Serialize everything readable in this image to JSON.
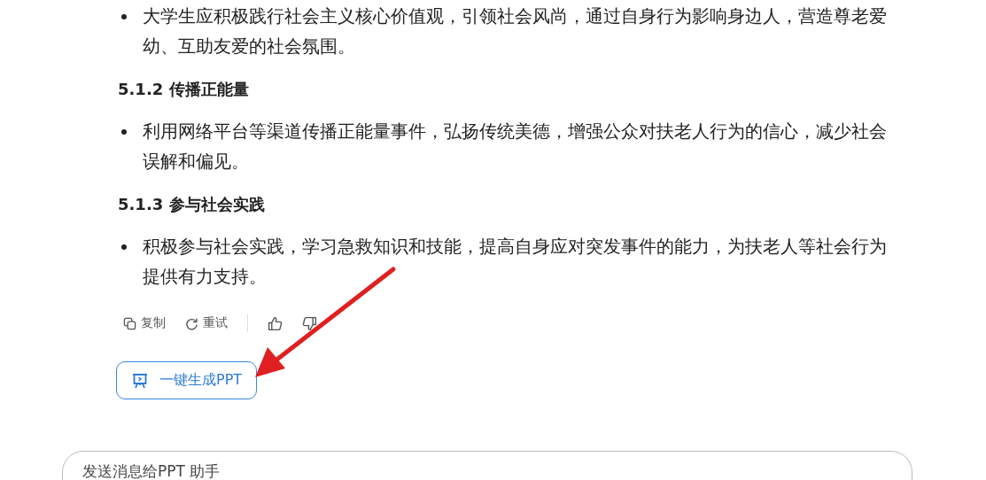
{
  "sections": [
    {
      "bullets": [
        "大学生应积极践行社会主义核心价值观，引领社会风尚，通过自身行为影响身边人，营造尊老爱幼、互助友爱的社会氛围。"
      ]
    },
    {
      "heading": "5.1.2 传播正能量",
      "bullets": [
        "利用网络平台等渠道传播正能量事件，弘扬传统美德，增强公众对扶老人行为的信心，减少社会误解和偏见。"
      ]
    },
    {
      "heading": "5.1.3 参与社会实践",
      "bullets": [
        "积极参与社会实践，学习急救知识和技能，提高自身应对突发事件的能力，为扶老人等社会行为提供有力支持。"
      ]
    }
  ],
  "actions": [
    {
      "kind": "copy",
      "label": "复制"
    },
    {
      "kind": "retry",
      "label": "重试"
    },
    {
      "kind": "like"
    },
    {
      "kind": "dislike"
    }
  ],
  "generate_button": {
    "label": "一键生成PPT"
  },
  "message_input": {
    "placeholder": "发送消息给PPT 助手"
  }
}
